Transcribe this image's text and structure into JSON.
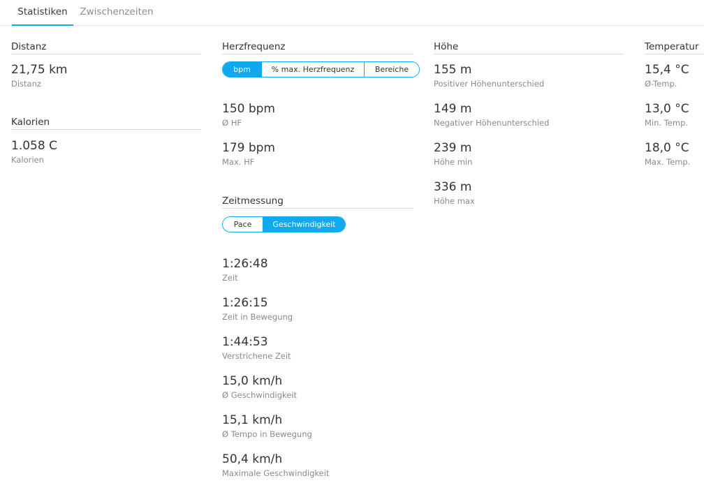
{
  "tabs": [
    {
      "label": "Statistiken"
    },
    {
      "label": "Zwischenzeiten"
    }
  ],
  "distance": {
    "title": "Distanz",
    "stats": [
      {
        "value": "21,75 km",
        "label": "Distanz"
      }
    ]
  },
  "calories": {
    "title": "Kalorien",
    "stats": [
      {
        "value": "1.058 C",
        "label": "Kalorien"
      }
    ]
  },
  "heart_rate": {
    "title": "Herzfrequenz",
    "toggle": [
      {
        "label": "bpm",
        "selected": true
      },
      {
        "label": "% max. Herzfrequenz",
        "selected": false
      },
      {
        "label": "Bereiche",
        "selected": false
      }
    ],
    "stats": [
      {
        "value": "150 bpm",
        "label": "Ø HF"
      },
      {
        "value": "179 bpm",
        "label": "Max. HF"
      }
    ]
  },
  "timing": {
    "title": "Zeitmessung",
    "toggle": [
      {
        "label": "Pace",
        "selected": false
      },
      {
        "label": "Geschwindigkeit",
        "selected": true
      }
    ],
    "stats": [
      {
        "value": "1:26:48",
        "label": "Zeit"
      },
      {
        "value": "1:26:15",
        "label": "Zeit in Bewegung"
      },
      {
        "value": "1:44:53",
        "label": "Verstrichene Zeit"
      },
      {
        "value": "15,0 km/h",
        "label": "Ø Geschwindigkeit"
      },
      {
        "value": "15,1 km/h",
        "label": "Ø Tempo in Bewegung"
      },
      {
        "value": "50,4 km/h",
        "label": "Maximale Geschwindigkeit"
      }
    ]
  },
  "elevation": {
    "title": "Höhe",
    "stats": [
      {
        "value": "155 m",
        "label": "Positiver Höhenunterschied"
      },
      {
        "value": "149 m",
        "label": "Negativer Höhenunterschied"
      },
      {
        "value": "239 m",
        "label": "Höhe min"
      },
      {
        "value": "336 m",
        "label": "Höhe max"
      }
    ]
  },
  "temperature": {
    "title": "Temperatur",
    "stats": [
      {
        "value": "15,4 °C",
        "label": "Ø-Temp."
      },
      {
        "value": "13,0 °C",
        "label": "Min. Temp."
      },
      {
        "value": "18,0 °C",
        "label": "Max. Temp."
      }
    ]
  },
  "colors": {
    "accent": "#11a9ed",
    "text": "#333333",
    "muted": "#8a8a8a",
    "divider": "#d9d9d9"
  }
}
